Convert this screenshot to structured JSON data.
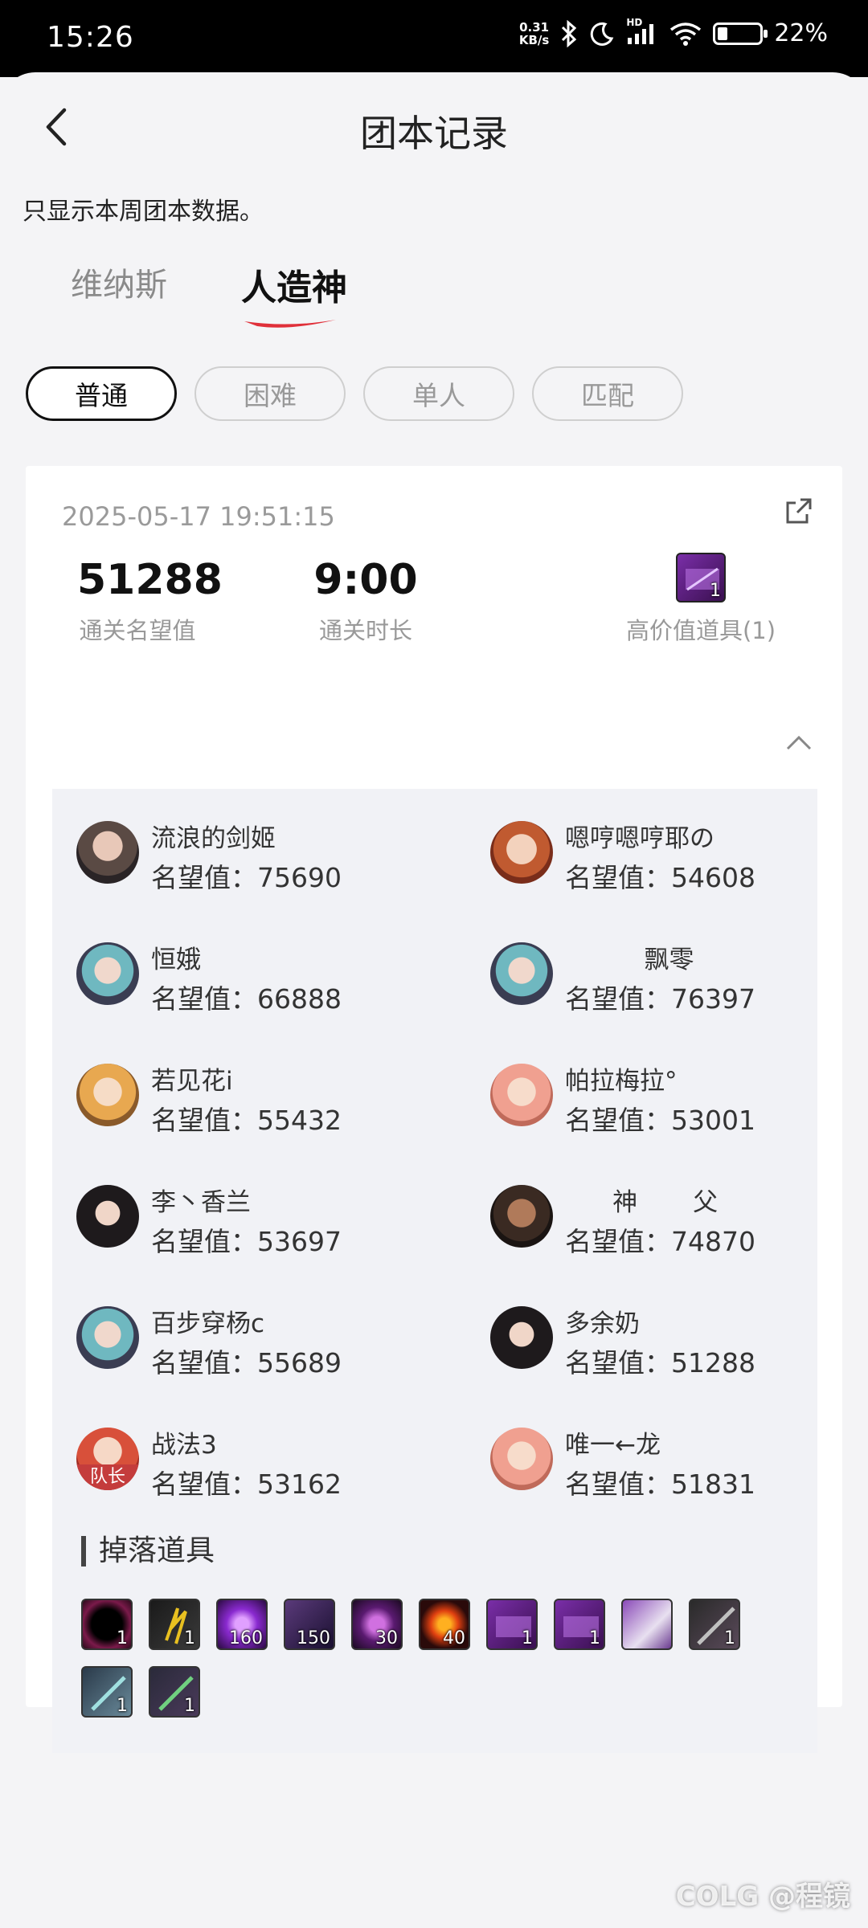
{
  "status_bar": {
    "time": "15:26",
    "net_speed_value": "0.31",
    "net_speed_unit": "KB/s",
    "hd": "HD",
    "battery": "22%"
  },
  "header": {
    "title": "团本记录"
  },
  "notice": "只显示本周团本数据。",
  "tabs": [
    {
      "label": "维纳斯",
      "active": false
    },
    {
      "label": "人造神",
      "active": true
    }
  ],
  "filters": [
    {
      "label": "普通",
      "active": true
    },
    {
      "label": "困难",
      "active": false
    },
    {
      "label": "单人",
      "active": false
    },
    {
      "label": "匹配",
      "active": false
    }
  ],
  "record": {
    "datetime": "2025-05-17 19:51:15",
    "reputation_value": "51288",
    "reputation_label": "通关名望值",
    "duration_value": "9:00",
    "duration_label": "通关时长",
    "high_value_label": "高价值道具(1)",
    "high_value_qty": "1",
    "members": [
      {
        "name": "流浪的剑姬",
        "rep": "名望值：75690"
      },
      {
        "name": "嗯哼嗯哼耶の",
        "rep": "名望值：54608"
      },
      {
        "name": "恒娥",
        "rep": "名望值：66888"
      },
      {
        "name": "          飘零",
        "rep": "名望值：76397"
      },
      {
        "name": "若见花i",
        "rep": "名望值：55432"
      },
      {
        "name": "帕拉梅拉°",
        "rep": "名望值：53001"
      },
      {
        "name": "李丶香兰",
        "rep": "名望值：53697"
      },
      {
        "name": "      神       父",
        "rep": "名望值：74870"
      },
      {
        "name": "百步穿杨c",
        "rep": "名望值：55689"
      },
      {
        "name": "多余奶",
        "rep": "名望值：51288"
      },
      {
        "name": "战法3",
        "rep": "名望值：53162"
      },
      {
        "name": "唯一←龙",
        "rep": "名望值：51831"
      }
    ],
    "leader_badge": "队长",
    "drops_title": "掉落道具",
    "drops": [
      {
        "qty": "1"
      },
      {
        "qty": "1"
      },
      {
        "qty": "160"
      },
      {
        "qty": "150"
      },
      {
        "qty": "30"
      },
      {
        "qty": "40"
      },
      {
        "qty": "1"
      },
      {
        "qty": "1"
      },
      {
        "qty": ""
      },
      {
        "qty": "1"
      },
      {
        "qty": "1"
      },
      {
        "qty": "1"
      }
    ]
  },
  "watermark": "COLG @程镜"
}
